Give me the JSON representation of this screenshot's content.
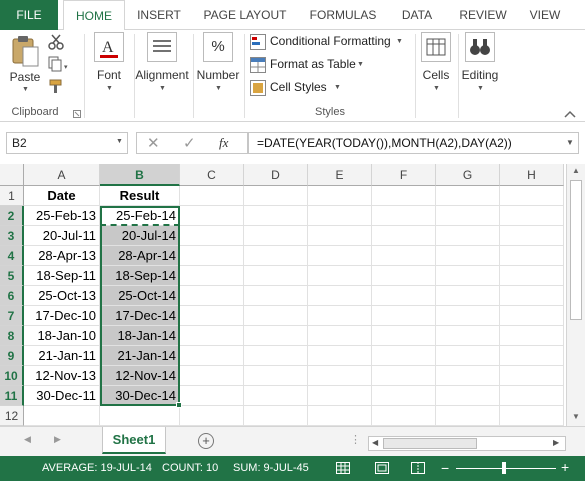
{
  "ribbon_tabs": [
    "FILE",
    "HOME",
    "INSERT",
    "PAGE LAYOUT",
    "FORMULAS",
    "DATA",
    "REVIEW",
    "VIEW"
  ],
  "ribbon": {
    "clipboard": {
      "paste": "Paste",
      "label": "Clipboard"
    },
    "font": "Font",
    "alignment": "Alignment",
    "number": "Number",
    "number_symbol": "%",
    "styles": {
      "conditional": "Conditional Formatting",
      "format_table": "Format as Table",
      "cell_styles": "Cell Styles",
      "label": "Styles"
    },
    "cells": "Cells",
    "editing": "Editing"
  },
  "formula_bar": {
    "name_box": "B2",
    "fx": "fx",
    "formula": "=DATE(YEAR(TODAY()),MONTH(A2),DAY(A2))"
  },
  "columns": [
    "A",
    "B",
    "C",
    "D",
    "E",
    "F",
    "G",
    "H"
  ],
  "rows": [
    "1",
    "2",
    "3",
    "4",
    "5",
    "6",
    "7",
    "8",
    "9",
    "10",
    "11",
    "12"
  ],
  "headers": {
    "date": "Date",
    "result": "Result"
  },
  "dates": [
    "25-Feb-13",
    "20-Jul-11",
    "28-Apr-13",
    "18-Sep-11",
    "25-Oct-13",
    "17-Dec-10",
    "18-Jan-10",
    "21-Jan-11",
    "12-Nov-13",
    "30-Dec-11"
  ],
  "results": [
    "25-Feb-14",
    "20-Jul-14",
    "28-Apr-14",
    "18-Sep-14",
    "25-Oct-14",
    "17-Dec-14",
    "18-Jan-14",
    "21-Jan-14",
    "12-Nov-14",
    "30-Dec-14"
  ],
  "sheet_tab": "Sheet1",
  "status_bar": {
    "average": "AVERAGE: 19-JUL-14",
    "count": "COUNT: 10",
    "sum": "SUM: 9-JUL-45"
  },
  "colors": {
    "accent": "#217346",
    "selection_fill": "#c8c8c8"
  }
}
